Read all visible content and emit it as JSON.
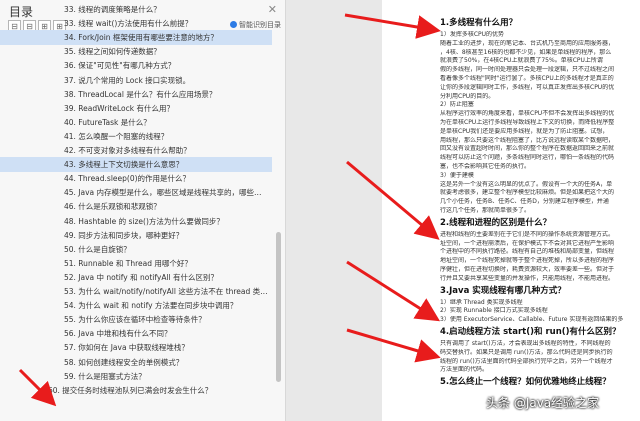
{
  "toc": {
    "title": "目录",
    "close_label": "✕",
    "tools": [
      "⊟",
      "⊟",
      "⊞",
      "⊞"
    ],
    "smart_label": "智能识别目录",
    "items": [
      "33. 线程的调度策略是什么？",
      "33. 线程 wait()方法使用有什么前提？",
      "34. Fork/Join 框架使用有哪些要注意的地方？",
      "35. 线程之间如何传递数据？",
      "36. 保证\"可见性\"有哪几种方式？",
      "37. 说几个常用的 Lock 接口实现锁。",
      "38. ThreadLocal 是什么？有什么应用场景？",
      "39. ReadWriteLock 有什么用？",
      "40. FutureTask 是什么？",
      "41. 怎么唤醒一个阻塞的线程？",
      "42. 不可变对象对多线程有什么帮助？",
      "43. 多线程上下文切换是什么意思？",
      "44. Thread.sleep(0)的作用是什么？",
      "45. Java 内存模型是什么，哪些区域是线程共享的，哪些是线程...",
      "46. 什么是乐观锁和悲观锁？",
      "48. Hashtable 的 size()方法为什么要做同步？",
      "49. 同步方法和同步块，哪种更好？",
      "50. 什么是自旋锁？",
      "51. Runnable 和 Thread 用哪个好？",
      "52. Java 中 notify 和 notifyAll 有什么区别？",
      "53. 为什么 wait/notify/notifyAll 这些方法不在 thread 类里面？",
      "54. 为什么 wait 和 notify 方法要在同步块中调用？",
      "55. 为什么你应该在循环中检查等待条件？",
      "56. Java 中堆和栈有什么不同？",
      "57. 你如何在 Java 中获取线程堆栈？",
      "58. 如何创建线程安全的单例模式？",
      "59. 什么是阻塞式方法？",
      "60. 提交任务时线程池队列已满会时发会生什么？"
    ]
  },
  "doc": {
    "sections": [
      {
        "heading": "1.多线程有什么用？",
        "lines": [
          "1）发挥多核CPU的优势",
          "随着工业的进步，现在的笔记本、台式机乃至商用的应用服务器，",
          "，4核、8核甚至16核的也都不少见，如果是单线程的程序，那么",
          "就浪费了50%，在4核CPU上就浪费了75%。单核CPU上所谓",
          "假的多线程，同一时间处理器只会处理一段逻辑，只不过线程之间",
          "看着像多个线程\"同时\"运行罢了。多核CPU上的多线程才是真正的",
          "让你的多段逻辑同时工作，多线程，可以真正发挥出多核CPU的优",
          "分利用CPU的目的。",
          "2）防止阻塞",
          "从程序运行效率的角度来看，单核CPU不但不会发挥出多线程的优",
          "为在单核CPU上运行多线程导致线程上下文的切换，而降低程序整",
          "是单核CPU我们还是要应用多线程，就是为了防止阻塞。试想，",
          "用线程，那么只要这个线程阻塞了，比方说远程读取某个数据吧，",
          "回又没有设置超时时间，那么你的整个程序在数据返回回来之前就",
          "线程可以防止这个问题，多条线程同时运行，哪怕一条线程的代码",
          "塞，也不会影响其它任务的执行。",
          "3）便于建模",
          "这是另外一个没有这么明显的优点了。假设有一个大的任务A，单",
          "就要考虑很多，建立整个程序模型比较麻烦。但是如果把这个大的",
          "几个小任务，任务B、任务C、任务D，分别建立程序模型，并通",
          "行这几个任务，那就简单很多了。"
        ]
      },
      {
        "heading": "2.线程和进程的区别是什么？",
        "lines": [
          "进程和线程的主要差别在于它们是不同的操作系统资源管理方式。",
          "址空间，一个进程崩溃后，在保护模式下不会对其它进程产生影响",
          "个进程中的不同执行路径。线程有自己的堆栈和局部变量，但线程",
          "地址空间，一个线程死掉就等于整个进程死掉，所以多进程的程序",
          "序健壮，但在进程切换时，耗费资源较大，效率要差一些。但对于",
          "行并且又要共享某些变量的并发操作，只能用线程，不能用进程。"
        ]
      },
      {
        "heading": "3.Java 实现线程有哪几种方式？",
        "lines": [
          "1）继承 Thread 类实现多线程",
          "2）实现 Runnable 接口方式实现多线程",
          "3）使用 ExecutorService、Callable、Future 实现有返回结果的多"
        ]
      },
      {
        "heading": "4.启动线程方法 start()和 run()有什么区别？",
        "lines": [
          "只有调用了 start()方法，才会表现出多线程的特性，不同线程的",
          "码交替执行。如果只是调用 run()方法，那么代码还是同步执行的",
          "线程的 run()方法里面的代码全部执行完毕之后，另外一个线程才",
          "方法里面的代码。"
        ]
      },
      {
        "heading": "5.怎么终止一个线程？如何优雅地终止线程？",
        "lines": []
      }
    ]
  },
  "watermark": "头条 @Java经验之家"
}
